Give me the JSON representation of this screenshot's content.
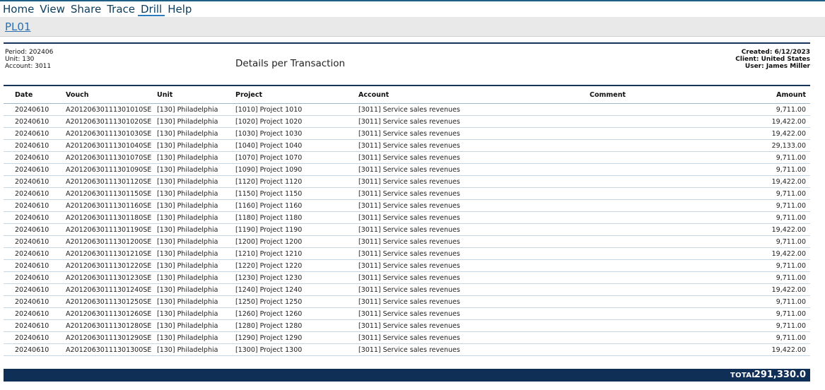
{
  "menu": {
    "items": [
      {
        "label": "Home"
      },
      {
        "label": "View"
      },
      {
        "label": "Share"
      },
      {
        "label": "Trace"
      },
      {
        "label": "Drill"
      },
      {
        "label": "Help"
      }
    ],
    "active": "Drill"
  },
  "breadcrumb": {
    "label": "PL01"
  },
  "header": {
    "period": "Period: 202406",
    "unit": "Unit: 130",
    "account": "Account: 3011",
    "title": "Details per Transaction",
    "created": "Created: 6/12/2023",
    "client": "Client: United States",
    "user": "User: James Miller"
  },
  "table": {
    "columns": [
      "Date",
      "Vouch",
      "Unit",
      "Project",
      "Account",
      "Comment",
      "Amount"
    ],
    "rows": [
      [
        "20240610",
        "A20120630111301010SE",
        "[130] Philadelphia",
        "[1010] Project 1010",
        "[3011] Service sales revenues",
        "",
        "9,711.00"
      ],
      [
        "20240610",
        "A20120630111301020SE",
        "[130] Philadelphia",
        "[1020] Project 1020",
        "[3011] Service sales revenues",
        "",
        "19,422.00"
      ],
      [
        "20240610",
        "A20120630111301030SE",
        "[130] Philadelphia",
        "[1030] Project 1030",
        "[3011] Service sales revenues",
        "",
        "19,422.00"
      ],
      [
        "20240610",
        "A20120630111301040SE",
        "[130] Philadelphia",
        "[1040] Project 1040",
        "[3011] Service sales revenues",
        "",
        "29,133.00"
      ],
      [
        "20240610",
        "A20120630111301070SE",
        "[130] Philadelphia",
        "[1070] Project 1070",
        "[3011] Service sales revenues",
        "",
        "9,711.00"
      ],
      [
        "20240610",
        "A20120630111301090SE",
        "[130] Philadelphia",
        "[1090] Project 1090",
        "[3011] Service sales revenues",
        "",
        "9,711.00"
      ],
      [
        "20240610",
        "A20120630111301120SE",
        "[130] Philadelphia",
        "[1120] Project 1120",
        "[3011] Service sales revenues",
        "",
        "19,422.00"
      ],
      [
        "20240610",
        "A20120630111301150SE",
        "[130] Philadelphia",
        "[1150] Project 1150",
        "[3011] Service sales revenues",
        "",
        "9,711.00"
      ],
      [
        "20240610",
        "A20120630111301160SE",
        "[130] Philadelphia",
        "[1160] Project 1160",
        "[3011] Service sales revenues",
        "",
        "9,711.00"
      ],
      [
        "20240610",
        "A20120630111301180SE",
        "[130] Philadelphia",
        "[1180] Project 1180",
        "[3011] Service sales revenues",
        "",
        "9,711.00"
      ],
      [
        "20240610",
        "A20120630111301190SE",
        "[130] Philadelphia",
        "[1190] Project 1190",
        "[3011] Service sales revenues",
        "",
        "19,422.00"
      ],
      [
        "20240610",
        "A20120630111301200SE",
        "[130] Philadelphia",
        "[1200] Project 1200",
        "[3011] Service sales revenues",
        "",
        "9,711.00"
      ],
      [
        "20240610",
        "A20120630111301210SE",
        "[130] Philadelphia",
        "[1210] Project 1210",
        "[3011] Service sales revenues",
        "",
        "19,422.00"
      ],
      [
        "20240610",
        "A20120630111301220SE",
        "[130] Philadelphia",
        "[1220] Project 1220",
        "[3011] Service sales revenues",
        "",
        "9,711.00"
      ],
      [
        "20240610",
        "A20120630111301230SE",
        "[130] Philadelphia",
        "[1230] Project 1230",
        "[3011] Service sales revenues",
        "",
        "9,711.00"
      ],
      [
        "20240610",
        "A20120630111301240SE",
        "[130] Philadelphia",
        "[1240] Project 1240",
        "[3011] Service sales revenues",
        "",
        "19,422.00"
      ],
      [
        "20240610",
        "A20120630111301250SE",
        "[130] Philadelphia",
        "[1250] Project 1250",
        "[3011] Service sales revenues",
        "",
        "9,711.00"
      ],
      [
        "20240610",
        "A20120630111301260SE",
        "[130] Philadelphia",
        "[1260] Project 1260",
        "[3011] Service sales revenues",
        "",
        "9,711.00"
      ],
      [
        "20240610",
        "A20120630111301280SE",
        "[130] Philadelphia",
        "[1280] Project 1280",
        "[3011] Service sales revenues",
        "",
        "9,711.00"
      ],
      [
        "20240610",
        "A20120630111301290SE",
        "[130] Philadelphia",
        "[1290] Project 1290",
        "[3011] Service sales revenues",
        "",
        "9,711.00"
      ],
      [
        "20240610",
        "A20120630111301300SE",
        "[130] Philadelphia",
        "[1300] Project 1300",
        "[3011] Service sales revenues",
        "",
        "19,422.00"
      ]
    ]
  },
  "total": {
    "label": "TOTAL",
    "value": "291,330.0"
  },
  "colors": {
    "accent": "#15355a",
    "link": "#2a6fb0",
    "menu_text": "#0b3d5c",
    "total_bar": "#0f2f57"
  }
}
